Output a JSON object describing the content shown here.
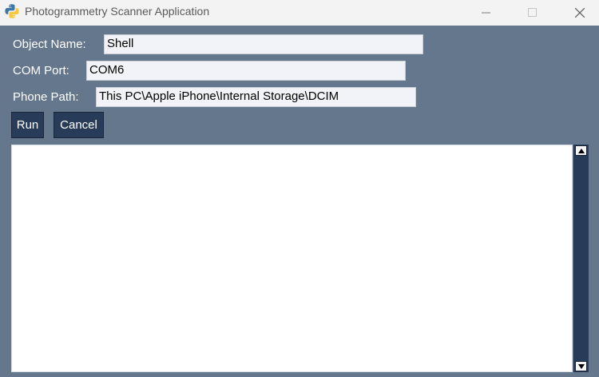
{
  "window": {
    "title": "Photogrammetry Scanner Application",
    "icon": "python-icon"
  },
  "form": {
    "object_name": {
      "label": "Object Name:",
      "value": "Shell"
    },
    "com_port": {
      "label": "COM Port:",
      "value": "COM6"
    },
    "phone_path": {
      "label": "Phone Path:",
      "value": "This PC\\Apple iPhone\\Internal Storage\\DCIM"
    }
  },
  "buttons": {
    "run": "Run",
    "cancel": "Cancel"
  },
  "output": {
    "text": ""
  },
  "colors": {
    "background": "#64778d",
    "button": "#283c59",
    "titlebar": "#f3f3f3"
  }
}
